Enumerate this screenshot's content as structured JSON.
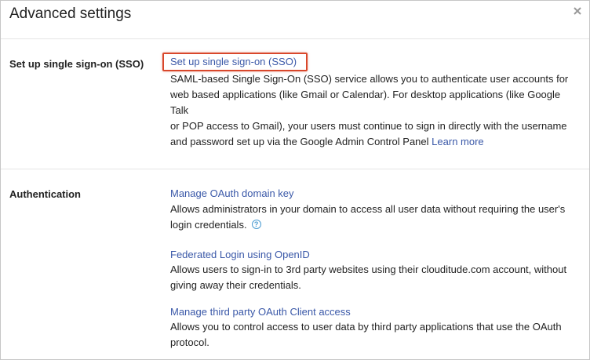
{
  "dialog": {
    "title": "Advanced settings",
    "close_label": "×"
  },
  "sso": {
    "label": "Set up single sign-on (SSO)",
    "link": "Set up single sign-on (SSO)",
    "description_lines": [
      "SAML-based Single Sign-On (SSO) service allows you to authenticate user accounts for",
      "web based applications (like Gmail or Calendar). For desktop applications (like Google Talk",
      "or POP access to Gmail), your users must continue to sign in directly with the username",
      "and password set up via the Google Admin Control Panel"
    ],
    "learn_more": "Learn more"
  },
  "authentication": {
    "label": "Authentication",
    "items": [
      {
        "link": "Manage OAuth domain key",
        "lines": [
          "Allows administrators in your domain to access all user data without requiring the user's",
          "login credentials."
        ],
        "help_icon": "?"
      },
      {
        "link": "Federated Login using OpenID",
        "lines": [
          "Allows users to sign-in to 3rd party websites using their clouditude.com account, without",
          "giving away their credentials."
        ]
      },
      {
        "link": "Manage third party OAuth Client access",
        "lines": [
          "Allows you to control access to user data by third party applications that use the OAuth",
          "protocol."
        ]
      }
    ]
  },
  "colors": {
    "link": "#3a58a8",
    "highlight_border": "#d9472b",
    "divider": "#e5e5e5"
  }
}
